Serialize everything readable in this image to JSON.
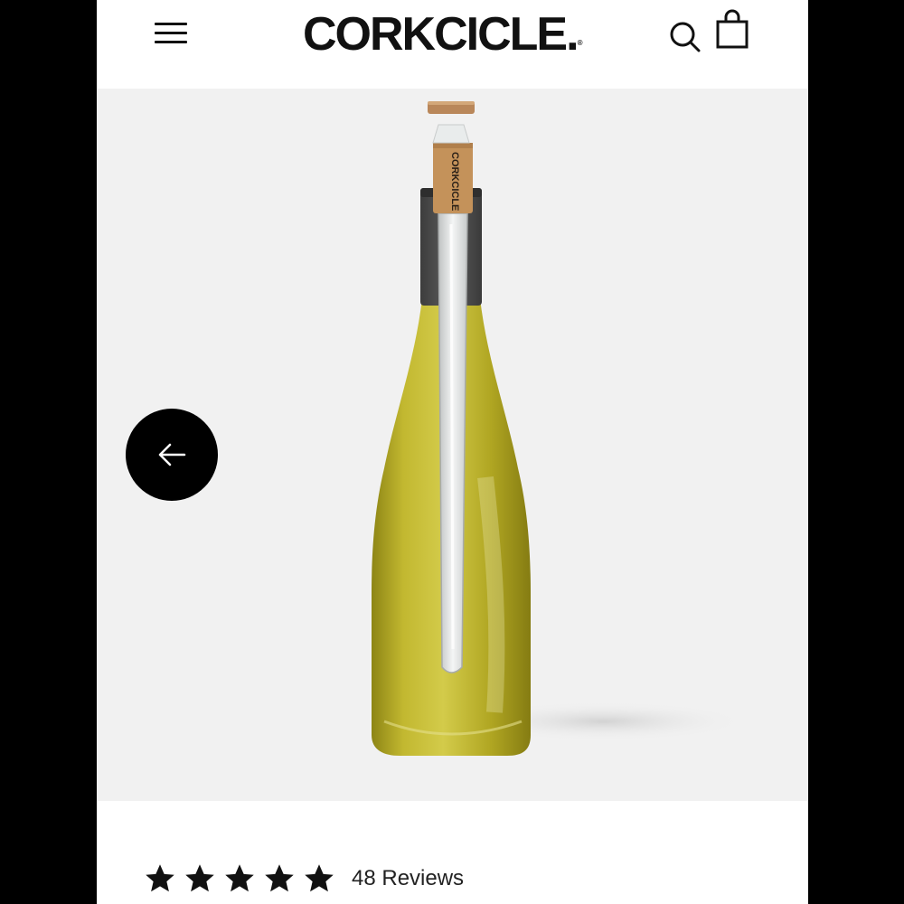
{
  "header": {
    "logo_text": "CORKCICLE.",
    "logo_mark": "®",
    "icons": {
      "menu": "hamburger-menu-icon",
      "search": "search-icon",
      "cart": "shopping-bag-icon"
    }
  },
  "hero": {
    "cork_label": "CORKCICLE",
    "prev_icon": "arrow-left-icon"
  },
  "reviews": {
    "rating": 5,
    "max_rating": 5,
    "count_label": "48 Reviews"
  },
  "colors": {
    "page_bg": "#ffffff",
    "hero_bg": "#f1f1f1",
    "frame_bg": "#000000",
    "text": "#111111",
    "bottle": "#b6ad27",
    "cork": "#c4925a"
  }
}
